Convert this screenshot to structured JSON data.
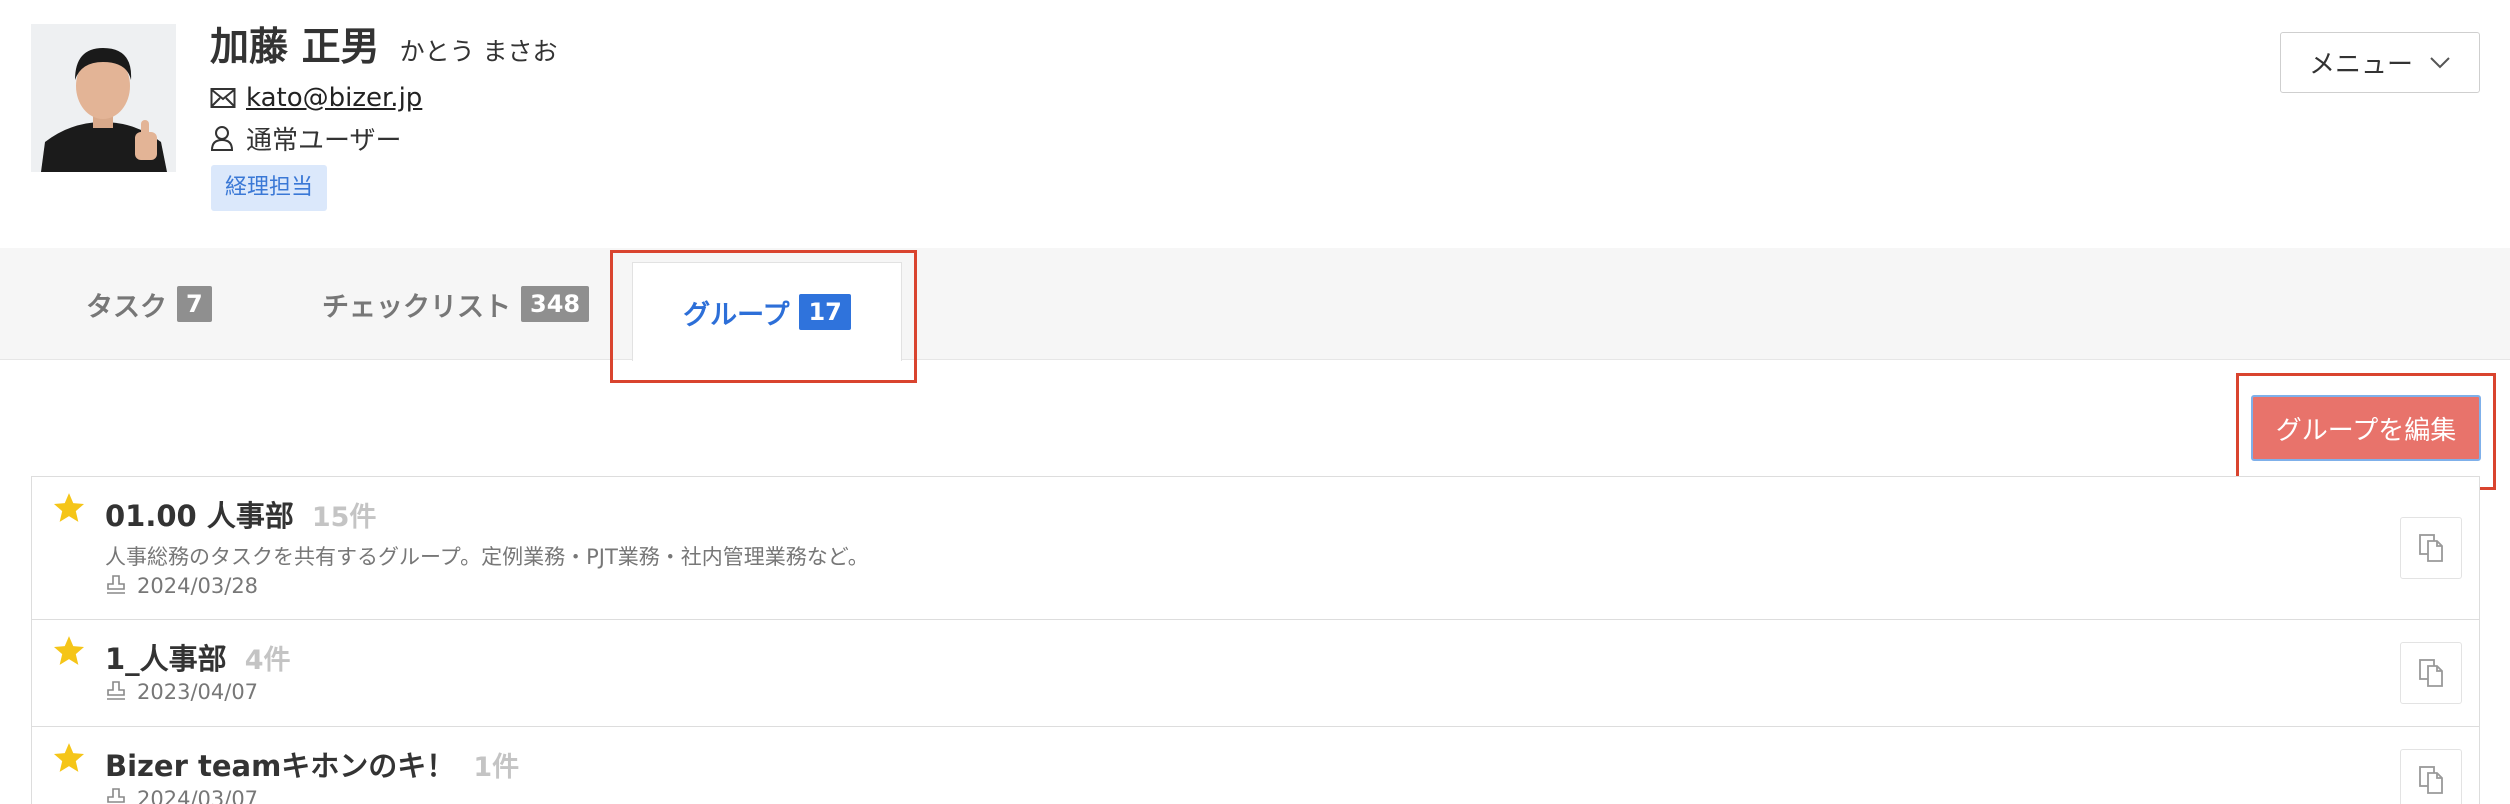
{
  "profile": {
    "name": "加藤 正男",
    "kana": "かとう まさお",
    "email": "kato@bizer.jp",
    "role": "通常ユーザー",
    "tag": "経理担当",
    "icons": {
      "email": "envelope-icon",
      "role": "user-icon"
    }
  },
  "menu": {
    "label": "メニュー",
    "icon": "chevron-down-icon"
  },
  "tabs": [
    {
      "label": "タスク",
      "count": "7",
      "active": false
    },
    {
      "label": "チェックリスト",
      "count": "348",
      "active": false
    },
    {
      "label": "グループ",
      "count": "17",
      "active": true
    }
  ],
  "edit_button": {
    "label": "グループを編集"
  },
  "groups": [
    {
      "name": "01.00 人事部",
      "count": "15件",
      "description": "人事総務のタスクを共有するグループ。定例業務・PJT業務・社内管理業務など。",
      "date": "2024/03/28",
      "starred": true
    },
    {
      "name": "1_人事部",
      "count": "4件",
      "description": "",
      "date": "2023/04/07",
      "starred": true
    },
    {
      "name": "Bizer teamキホンのキ！",
      "count": "1件",
      "description": "",
      "date": "2024/03/07",
      "starred": true
    }
  ],
  "colors": {
    "accent": "#2f73dc",
    "edit_button": "#e8736b",
    "highlight": "#d9442f",
    "star": "#f5c518",
    "tag_bg": "#dbe8fb",
    "tag_text": "#3a78d6"
  }
}
